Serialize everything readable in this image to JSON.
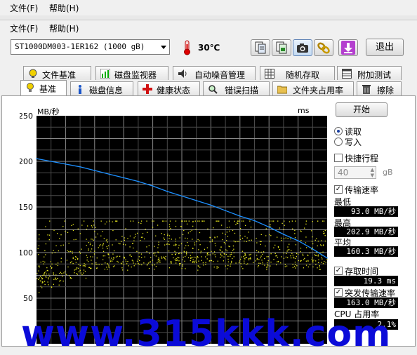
{
  "menu": {
    "file": "文件(F)",
    "help": "帮助(H)"
  },
  "toolbar": {
    "drive": "ST1000DM003-1ER162 (1000 gB)",
    "temperature": "30℃",
    "exit_label": "退出",
    "buttons": [
      "copy-text-icon",
      "copy-image-icon",
      "camera-icon",
      "chain-icon",
      "download-arrow-icon"
    ]
  },
  "tabs_row1": [
    "文件基准",
    "磁盘监视器",
    "自动噪音管理",
    "随机存取",
    "附加测试"
  ],
  "tabs_row2": [
    "基准",
    "磁盘信息",
    "健康状态",
    "错误扫描",
    "文件夹占用率",
    "擦除"
  ],
  "active_tab": "基准",
  "start_label": "开始",
  "mode": {
    "read": "读取",
    "write": "写入",
    "selected": "read"
  },
  "quick_stroke": {
    "label": "快捷行程",
    "checked": false,
    "value": "40",
    "unit": "gB"
  },
  "transfer_rate": {
    "label": "传输速率",
    "checked": true
  },
  "stats": {
    "min_label": "最低",
    "min": "93.0 MB/秒",
    "max_label": "最高",
    "max": "202.9 MB/秒",
    "avg_label": "平均",
    "avg": "160.3 MB/秒"
  },
  "access_time": {
    "label": "存取时间",
    "checked": true,
    "value": "19.3 ms"
  },
  "burst_rate": {
    "label": "突发传输速率",
    "checked": true,
    "value": "163.0 MB/秒"
  },
  "cpu": {
    "label": "CPU 占用率",
    "value": "2.1%"
  },
  "watermark": "www.315kkk.com",
  "colors": {
    "transfer_line": "#1e90ff",
    "access_dots": "#e6e61e",
    "chart_bg": "#000000"
  },
  "chart_data": {
    "type": "line",
    "y_left_label": "MB/秒",
    "y_right_label": "ms",
    "y_left_range": [
      0,
      250
    ],
    "y_right_range": [
      0,
      50
    ],
    "y_left_ticks": [
      50,
      100,
      150,
      200,
      250
    ],
    "y_right_ticks": [
      10,
      20,
      30,
      40,
      50
    ],
    "x_range": [
      0,
      1000
    ],
    "x_ticks_visible": [
      "100",
      "400",
      "500",
      "800",
      "900",
      "1000"
    ],
    "x_unit": "gB",
    "series": [
      {
        "x": [
          0,
          50,
          100,
          150,
          200,
          250,
          300,
          350,
          400,
          450,
          500,
          550,
          600,
          650,
          700,
          750,
          800,
          850,
          900,
          950,
          1000
        ],
        "values": [
          203,
          200,
          197,
          194,
          190,
          186,
          182,
          178,
          173,
          167,
          162,
          157,
          152,
          146,
          140,
          135,
          128,
          120,
          113,
          104,
          94
        ]
      }
    ],
    "access_time_ms_mean": 19.3,
    "access_time_ms_range": [
      8,
      27
    ]
  }
}
